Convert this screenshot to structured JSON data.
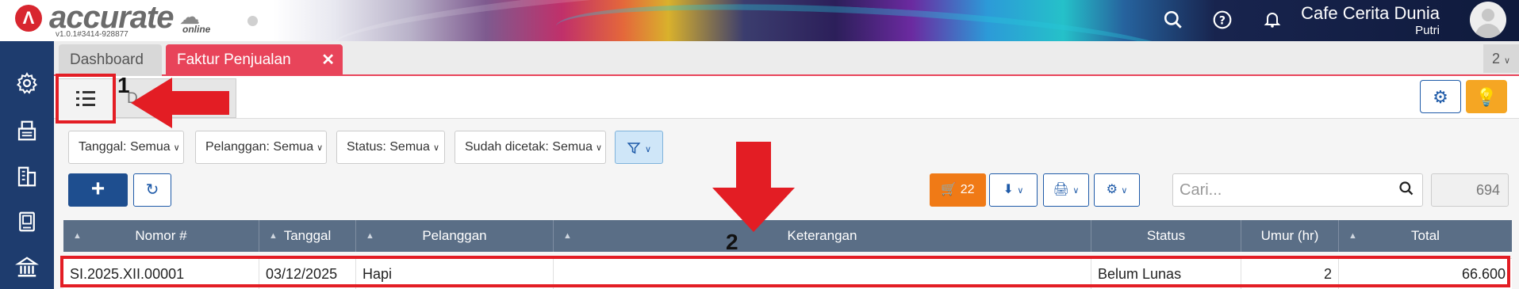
{
  "header": {
    "logo_text": "accurate",
    "logo_suffix": "online",
    "version": "v1.0.1#3414-928877",
    "company": "Cafe Cerita Dunia",
    "user": "Putri",
    "icons": [
      "search-icon",
      "help-icon",
      "bell-icon",
      "avatar"
    ]
  },
  "sidebar": {
    "items": [
      "gear-icon",
      "fax-icon",
      "building-icon",
      "book-icon",
      "bank-icon"
    ]
  },
  "tabs": {
    "items": [
      {
        "label": "Dashboard",
        "active": false
      },
      {
        "label": "Faktur Penjualan",
        "active": true
      }
    ],
    "overflow_count": "2"
  },
  "filters": {
    "tanggal": "Tanggal: Semua",
    "pelanggan": "Pelanggan: Semua",
    "status": "Status: Semua",
    "dicetak": "Sudah dicetak: Semua"
  },
  "toolbar": {
    "cart_count": "22",
    "search_placeholder": "Cari...",
    "total_count": "694"
  },
  "table": {
    "columns": [
      "Nomor #",
      "Tanggal",
      "Pelanggan",
      "Keterangan",
      "Status",
      "Umur (hr)",
      "Total"
    ],
    "rows": [
      {
        "nomor": "SI.2025.XII.00001",
        "tanggal": "03/12/2025",
        "pelanggan": "Hapi",
        "keterangan": "",
        "status": "Belum Lunas",
        "umur": "2",
        "total": "66.600"
      }
    ]
  },
  "annotations": {
    "label_1": "1",
    "label_2": "2",
    "tab_partial": "D"
  },
  "colors": {
    "accent": "#e8445a",
    "primary": "#1e4e8f",
    "sidebar": "#1e3c6e",
    "table_header": "#5a6e86",
    "annotation": "#e31d24",
    "cart_button": "#f07a16",
    "idea_button": "#f5a623"
  }
}
